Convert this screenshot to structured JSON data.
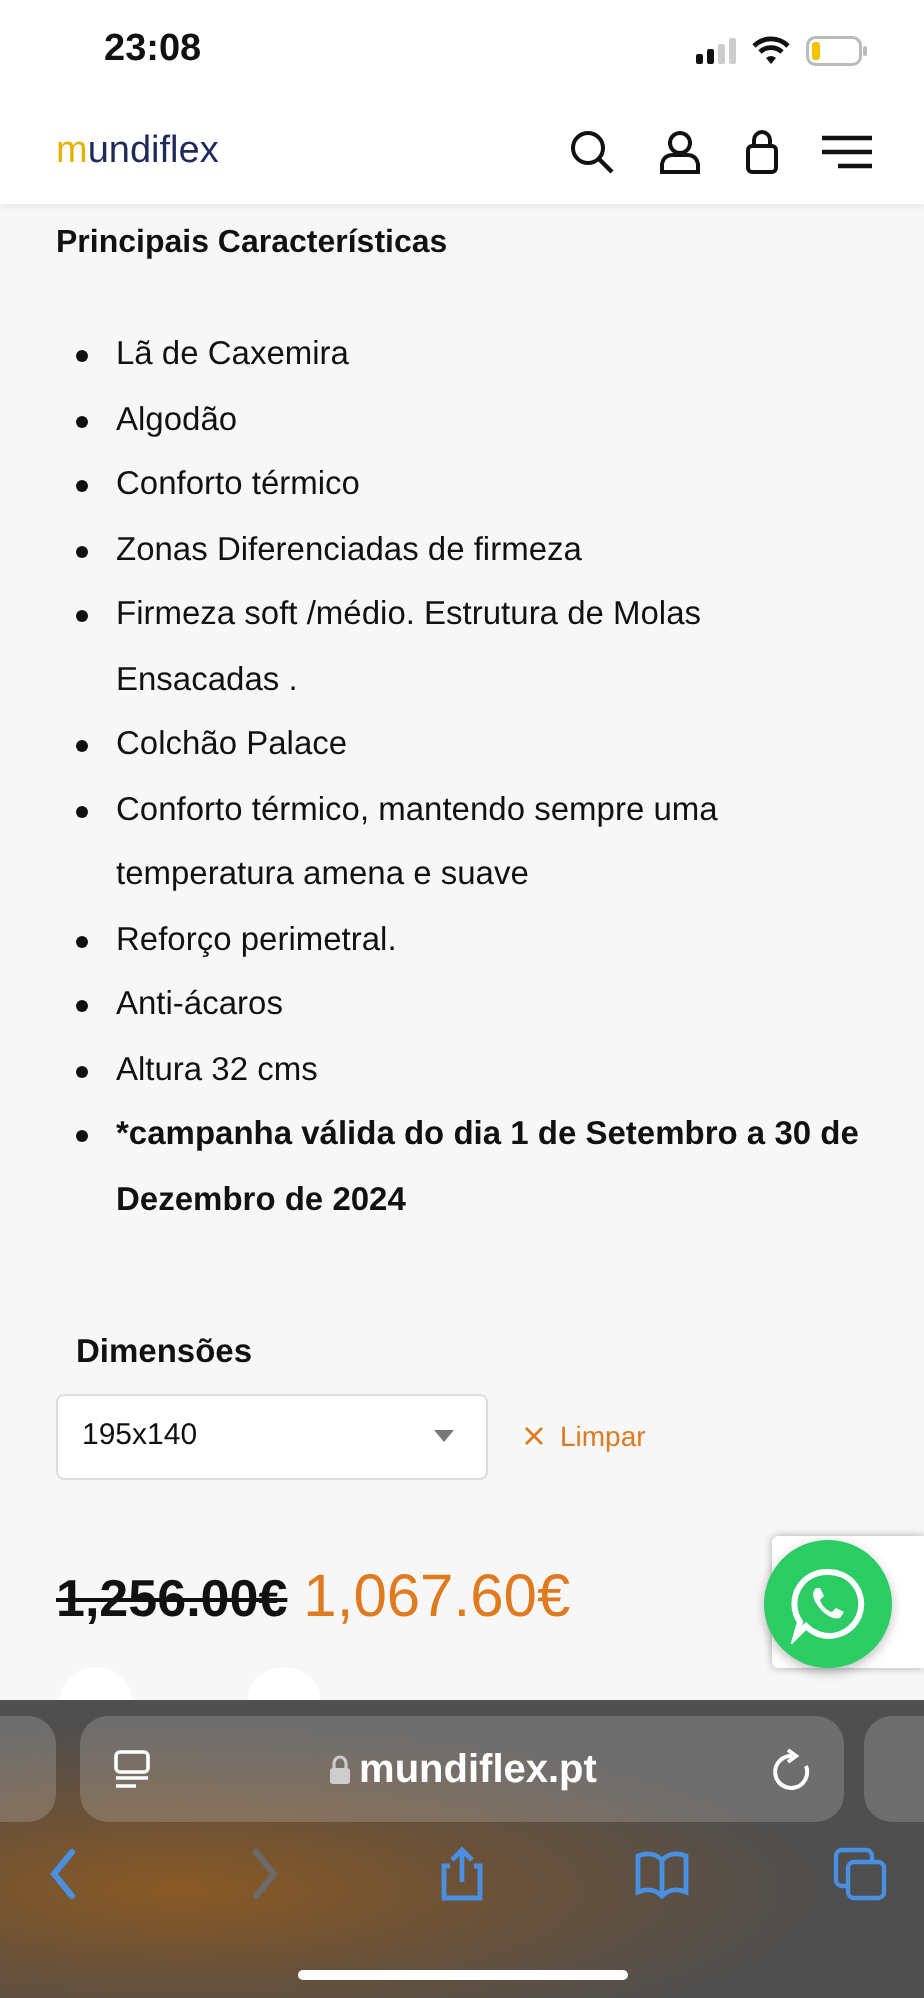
{
  "status_bar": {
    "time": "23:08"
  },
  "header": {
    "logo": {
      "accent": "m",
      "rest": "undiflex"
    }
  },
  "features": {
    "title": "Principais Características",
    "items": [
      {
        "text": "Lã de Caxemira",
        "bold": false
      },
      {
        "text": "Algodão",
        "bold": false
      },
      {
        "text": "Conforto térmico",
        "bold": false
      },
      {
        "text": "Zonas Diferenciadas de firmeza",
        "bold": false
      },
      {
        "text": "Firmeza soft /médio. Estrutura de Molas Ensacadas .",
        "bold": false
      },
      {
        "text": "Colchão Palace",
        "bold": false
      },
      {
        "text": "Conforto térmico, mantendo sempre uma temperatura amena e suave",
        "bold": false
      },
      {
        "text": "Reforço perimetral.",
        "bold": false
      },
      {
        "text": "Anti-ácaros",
        "bold": false
      },
      {
        "text": "Altura 32 cms",
        "bold": false
      },
      {
        "text": "*campanha válida do dia 1 de Setembro  a 30 de Dezembro de 2024",
        "bold": true
      }
    ]
  },
  "dimensions": {
    "label": "Dimensões",
    "value": "195x140",
    "clear": "Limpar"
  },
  "price": {
    "old": "1,256.00€",
    "new": "1,067.60€"
  },
  "browser": {
    "url": "mundiflex.pt"
  }
}
